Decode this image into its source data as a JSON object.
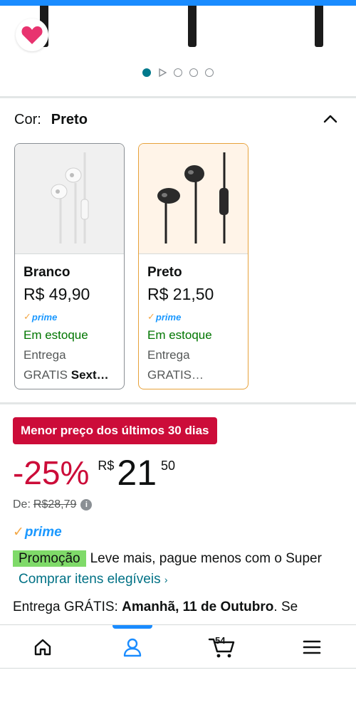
{
  "gallery": {
    "dots_count": 5,
    "active_index": 0
  },
  "color_selector": {
    "label": "Cor:",
    "selected": "Preto",
    "options": [
      {
        "name": "Branco",
        "price": "R$ 49,90",
        "prime": "prime",
        "stock": "Em estoque",
        "delivery_label": "Entrega",
        "delivery_free": "GRATIS",
        "delivery_day": "Sext…",
        "selected": false
      },
      {
        "name": "Preto",
        "price": "R$ 21,50",
        "prime": "prime",
        "stock": "Em estoque",
        "delivery_label": "Entrega",
        "delivery_free": "GRATIS…",
        "delivery_day": "",
        "selected": true
      }
    ]
  },
  "price": {
    "deal_badge": "Menor preço dos últimos 30 dias",
    "discount": "-25%",
    "currency": "R$",
    "whole": "21",
    "cents": "50",
    "list_label": "De:",
    "list_price": "R$28,79",
    "info_icon": "i"
  },
  "prime_label": "prime",
  "promotion": {
    "tag": "Promoção",
    "text": "Leve mais, pague menos com o Super",
    "link": "Comprar itens elegíveis",
    "link_chevron": "›"
  },
  "delivery": {
    "prefix": "Entrega GRÁTIS:",
    "date": "Amanhã, 11 de Outubro",
    "suffix": ". Se"
  },
  "bottom_nav": {
    "cart_count": "54",
    "active": "account"
  },
  "colors": {
    "accent_blue": "#1a8cff",
    "deal_red": "#cc0c39",
    "stock_green": "#007600",
    "link_teal": "#007185",
    "promo_green": "#7fda69",
    "selected_border": "#e7a23b",
    "heart_pink": "#e8336f"
  }
}
